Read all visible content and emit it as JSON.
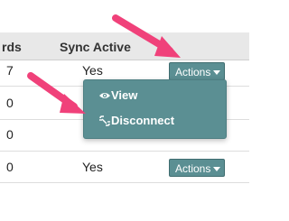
{
  "table": {
    "headers": {
      "records_fragment": "rds",
      "sync_active": "Sync Active"
    },
    "rows": [
      {
        "count": "7",
        "sync": "Yes",
        "action": "Actions"
      },
      {
        "count": "0",
        "sync": "",
        "action": ""
      },
      {
        "count": "0",
        "sync": "",
        "action": ""
      },
      {
        "count": "0",
        "sync": "Yes",
        "action": "Actions"
      }
    ]
  },
  "dropdown_menu": {
    "items": [
      {
        "label": "View",
        "icon": "eye-icon"
      },
      {
        "label": "Disconnect",
        "icon": "broken-link-icon"
      }
    ]
  },
  "colors": {
    "button_bg": "#5b8f93",
    "annotation_arrow": "#f0417a",
    "header_bg": "#e8e8e8"
  }
}
